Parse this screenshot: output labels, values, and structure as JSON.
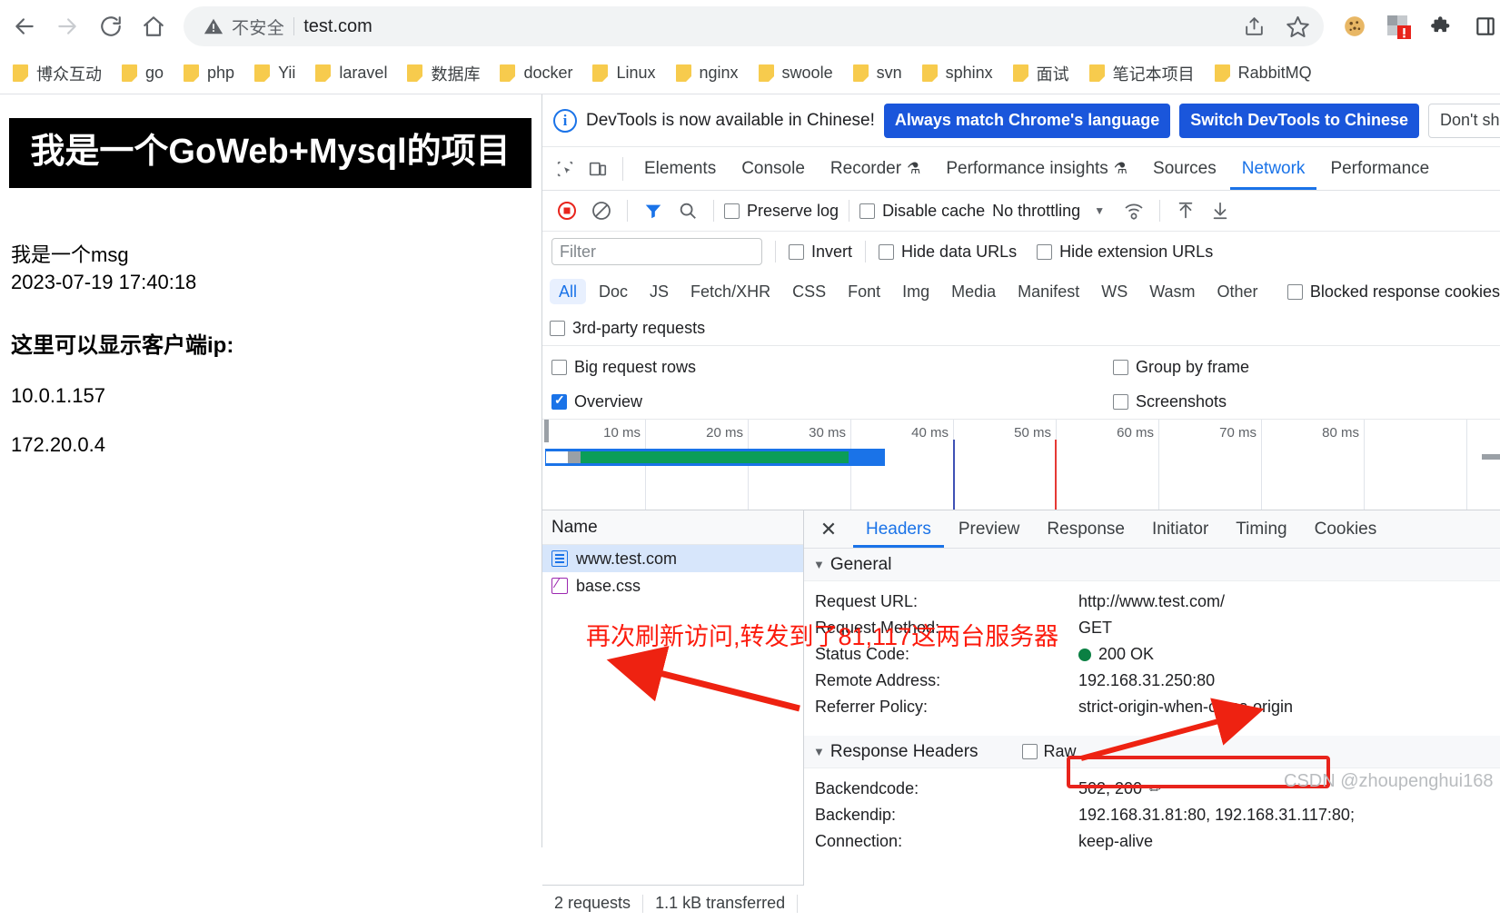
{
  "browser": {
    "nav": {
      "back_icon": "arrow-left-icon",
      "forward_icon": "arrow-right-icon",
      "reload_icon": "reload-icon",
      "home_icon": "home-icon"
    },
    "omnibox": {
      "security_icon": "warning-triangle-icon",
      "security_label": "不安全",
      "url": "test.com"
    },
    "omni_actions": [
      "share-icon",
      "star-icon"
    ],
    "extensions": [
      "cookie-icon",
      "extension-alert-icon",
      "puzzle-icon",
      "sidepanel-icon"
    ],
    "bookmarks": [
      "博众互动",
      "go",
      "php",
      "Yii",
      "laravel",
      "数据库",
      "docker",
      "Linux",
      "nginx",
      "swoole",
      "svn",
      "sphinx",
      "面试",
      "笔记本项目",
      "RabbitMQ"
    ]
  },
  "page": {
    "banner": "我是一个GoWeb+Mysql的项目",
    "msg": "我是一个msg",
    "time": "2023-07-19 17:40:18",
    "ip_heading": "这里可以显示客户端ip:",
    "ips": [
      "10.0.1.157",
      "172.20.0.4"
    ]
  },
  "devtools": {
    "notice": {
      "text": "DevTools is now available in Chinese!",
      "btn_always": "Always match Chrome's language",
      "btn_switch": "Switch DevTools to Chinese",
      "btn_dismiss": "Don't show again"
    },
    "panel_tabs": [
      {
        "label": "Elements",
        "active": false,
        "flask": false
      },
      {
        "label": "Console",
        "active": false,
        "flask": false
      },
      {
        "label": "Recorder",
        "active": false,
        "flask": true
      },
      {
        "label": "Performance insights",
        "active": false,
        "flask": true
      },
      {
        "label": "Sources",
        "active": false,
        "flask": false
      },
      {
        "label": "Network",
        "active": true,
        "flask": false
      },
      {
        "label": "Performance",
        "active": false,
        "flask": false
      }
    ],
    "network_toolbar": {
      "record_icon": "record-stop-icon",
      "clear_icon": "clear-icon",
      "filter_icon": "funnel-icon",
      "search_icon": "search-icon",
      "preserve_log": "Preserve log",
      "disable_cache": "Disable cache",
      "throttling": "No throttling",
      "wifi_icon": "network-conditions-icon",
      "import_icon": "import-har-icon",
      "export_icon": "export-har-icon"
    },
    "filter_bar": {
      "placeholder": "Filter",
      "value": "",
      "invert": "Invert",
      "hide_data_urls": "Hide data URLs",
      "hide_extension_urls": "Hide extension URLs"
    },
    "type_filters": [
      "All",
      "Doc",
      "JS",
      "Fetch/XHR",
      "CSS",
      "Font",
      "Img",
      "Media",
      "Manifest",
      "WS",
      "Wasm",
      "Other"
    ],
    "active_type_filter": "All",
    "blocked_response_cookies": "Blocked response cookies",
    "third_party_requests": "3rd-party requests",
    "settings": {
      "big_request_rows": "Big request rows",
      "group_by_frame": "Group by frame",
      "overview": "Overview",
      "screenshots": "Screenshots"
    },
    "overview": {
      "ticks": [
        "10 ms",
        "20 ms",
        "30 ms",
        "40 ms",
        "50 ms",
        "60 ms",
        "70 ms",
        "80 ms"
      ]
    },
    "requests": {
      "column_header": "Name",
      "rows": [
        {
          "name": "www.test.com",
          "icon": "document-icon",
          "selected": true
        },
        {
          "name": "base.css",
          "icon": "stylesheet-icon",
          "selected": false
        }
      ]
    },
    "status_bar": {
      "requests": "2 requests",
      "transferred": "1.1 kB transferred"
    },
    "detail": {
      "close_icon": "close-icon",
      "tabs": [
        {
          "label": "Headers",
          "active": true
        },
        {
          "label": "Preview",
          "active": false
        },
        {
          "label": "Response",
          "active": false
        },
        {
          "label": "Initiator",
          "active": false
        },
        {
          "label": "Timing",
          "active": false
        },
        {
          "label": "Cookies",
          "active": false
        }
      ],
      "general_title": "General",
      "general": [
        {
          "key": "Request URL:",
          "value": "http://www.test.com/"
        },
        {
          "key": "Request Method:",
          "value": "GET"
        },
        {
          "key": "Status Code:",
          "value": "200 OK",
          "status_dot": "#0b8043"
        },
        {
          "key": "Remote Address:",
          "value": "192.168.31.250:80"
        },
        {
          "key": "Referrer Policy:",
          "value": "strict-origin-when-cross-origin"
        }
      ],
      "response_headers_title": "Response Headers",
      "raw_label": "Raw",
      "response_headers": [
        {
          "key": "Backendcode:",
          "value": "502, 200",
          "pencil": true
        },
        {
          "key": "Backendip:",
          "value": "192.168.31.81:80, 192.168.31.117:80;"
        },
        {
          "key": "Connection:",
          "value": "keep-alive"
        }
      ]
    }
  },
  "annotation": {
    "text": "再次刷新访问,转发到了81,117这两台服务器",
    "color": "#fc1b0d",
    "watermark": "CSDN @zhoupenghui168"
  }
}
